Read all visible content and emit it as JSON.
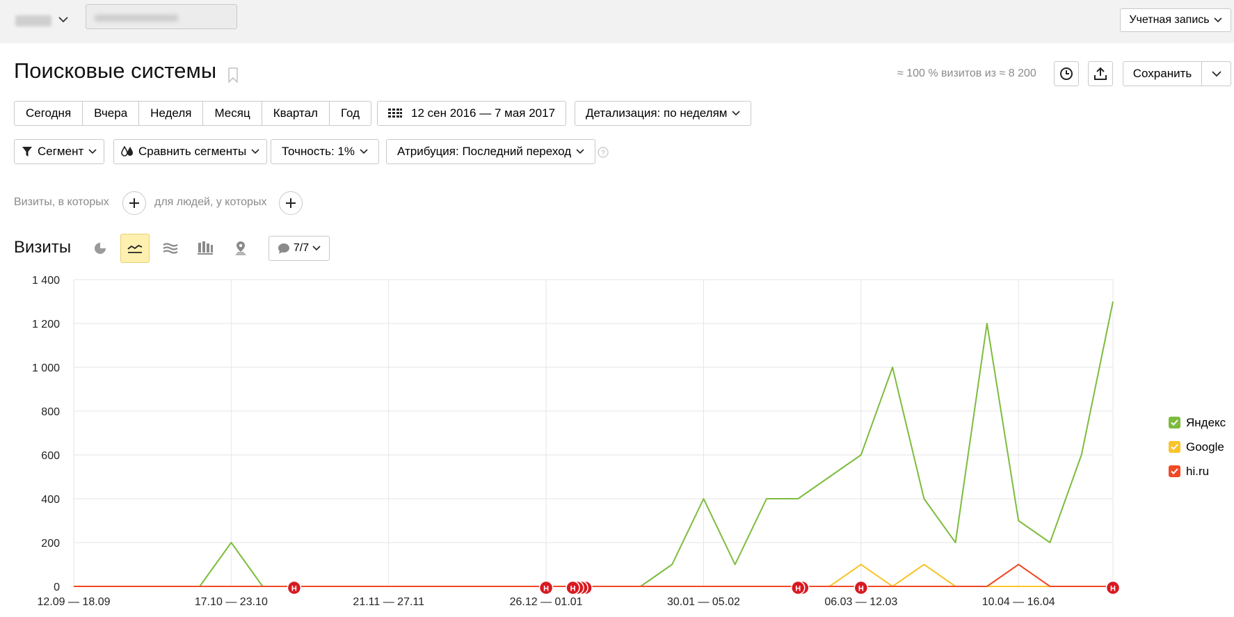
{
  "topbar": {
    "account_label": "Учетная запись"
  },
  "header": {
    "title": "Поисковые системы",
    "visits_info": "≈ 100 % визитов из ≈ 8 200",
    "save_label": "Сохранить"
  },
  "periods": [
    "Сегодня",
    "Вчера",
    "Неделя",
    "Месяц",
    "Квартал",
    "Год"
  ],
  "date_range": "12 сен 2016 — 7 мая 2017",
  "detail": "Детализация: по неделям",
  "segment": "Сегмент",
  "compare": "Сравнить сегменты",
  "accuracy": "Точность: 1%",
  "attribution": "Атрибуция: Последний переход",
  "conditions": {
    "visits": "Визиты, в которых",
    "people": "для людей, у которых"
  },
  "chart_header": {
    "title": "Визиты",
    "notes_count": "7/7"
  },
  "colors": {
    "yandex": "#7cbc3c",
    "google": "#f9c42b",
    "hiru": "#f04a24",
    "note": "#d81921",
    "active_btn": "#fff0b0"
  },
  "chart_data": {
    "type": "line",
    "ylim": [
      0,
      1400
    ],
    "yticks": [
      "0",
      "200",
      "400",
      "600",
      "800",
      "1 000",
      "1 200",
      "1 400"
    ],
    "xtick_labels": [
      "12.09 — 18.09",
      "17.10 — 23.10",
      "21.11 — 27.11",
      "26.12 — 01.01",
      "30.01 — 05.02",
      "06.03 — 12.03",
      "10.04 — 16.04"
    ],
    "xtick_positions": [
      0,
      5,
      10,
      15,
      20,
      25,
      30
    ],
    "x_count": 34,
    "series": [
      {
        "name": "Яндекс",
        "color": "#7cbc3c",
        "values": [
          0,
          0,
          0,
          0,
          0,
          200,
          0,
          0,
          0,
          0,
          0,
          0,
          0,
          0,
          0,
          0,
          0,
          0,
          0,
          100,
          400,
          100,
          400,
          400,
          500,
          600,
          1000,
          400,
          200,
          1200,
          300,
          200,
          600,
          1300
        ]
      },
      {
        "name": "Google",
        "color": "#f9c42b",
        "values": [
          0,
          0,
          0,
          0,
          0,
          0,
          0,
          0,
          0,
          0,
          0,
          0,
          0,
          0,
          0,
          0,
          0,
          0,
          0,
          0,
          0,
          0,
          0,
          0,
          0,
          100,
          0,
          100,
          0,
          0,
          0,
          0,
          0,
          0
        ]
      },
      {
        "name": "hi.ru",
        "color": "#f04a24",
        "values": [
          0,
          0,
          0,
          0,
          0,
          0,
          0,
          0,
          0,
          0,
          0,
          0,
          0,
          0,
          0,
          0,
          0,
          0,
          0,
          0,
          0,
          0,
          0,
          0,
          0,
          0,
          0,
          0,
          0,
          0,
          100,
          0,
          0,
          0
        ]
      }
    ],
    "notes": [
      {
        "x": 7,
        "count": 1
      },
      {
        "x": 15,
        "count": 1
      },
      {
        "x": 15.85,
        "count": 4
      },
      {
        "x": 23,
        "count": 2
      },
      {
        "x": 25,
        "count": 1
      },
      {
        "x": 33,
        "count": 1
      }
    ],
    "note_label": "Н"
  }
}
